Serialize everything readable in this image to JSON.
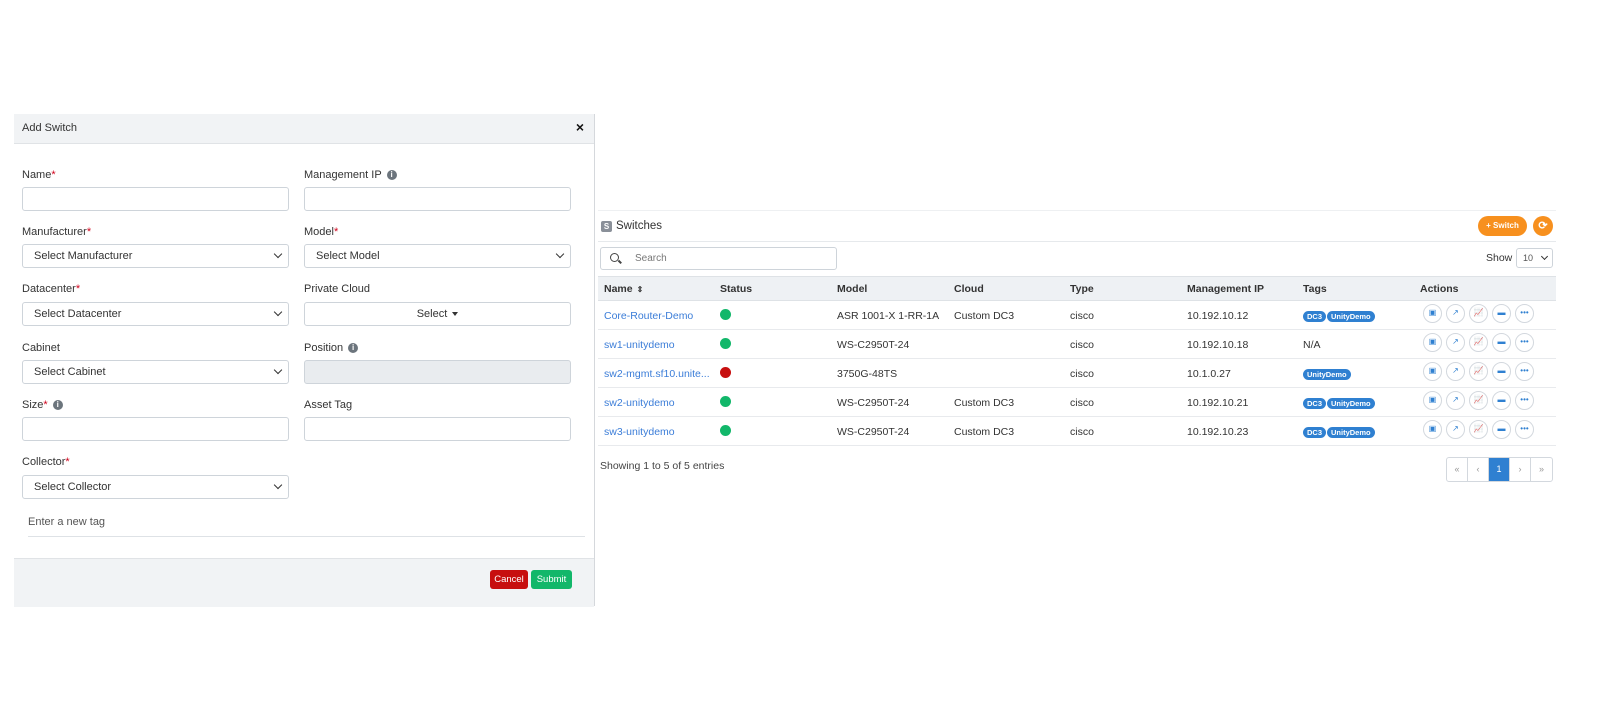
{
  "modal": {
    "title": "Add Switch",
    "close_icon": "×",
    "fields": {
      "name": {
        "label": "Name",
        "required": "*"
      },
      "management_ip": {
        "label": "Management IP",
        "info": "i"
      },
      "manufacturer": {
        "label": "Manufacturer",
        "required": "*",
        "value": "Select Manufacturer"
      },
      "model": {
        "label": "Model",
        "required": "*",
        "value": "Select Model"
      },
      "datacenter": {
        "label": "Datacenter",
        "required": "*",
        "value": "Select Datacenter"
      },
      "private_cloud": {
        "label": "Private Cloud",
        "value": "Select"
      },
      "cabinet": {
        "label": "Cabinet",
        "value": "Select Cabinet"
      },
      "position": {
        "label": "Position",
        "info": "i"
      },
      "size": {
        "label": "Size",
        "required": "*",
        "info": "i"
      },
      "asset_tag": {
        "label": "Asset Tag"
      },
      "collector": {
        "label": "Collector",
        "required": "*",
        "value": "Select Collector"
      },
      "tag_input": {
        "placeholder": "Enter a new tag"
      }
    },
    "buttons": {
      "cancel": "Cancel",
      "submit": "Submit"
    }
  },
  "switches": {
    "title": "Switches",
    "icon_letter": "S",
    "add_button": "+ Switch",
    "refresh_icon": "⟳",
    "search_placeholder": "Search",
    "show_label": "Show",
    "page_size": "10",
    "columns": [
      "Name",
      "Status",
      "Model",
      "Cloud",
      "Type",
      "Management IP",
      "Tags",
      "Actions"
    ],
    "sort_icon": "⇕",
    "colors": {
      "up": "#12b76a",
      "down": "#c70f0f",
      "accent": "#f7901e",
      "link": "#3b7dd8"
    },
    "rows": [
      {
        "name": "Core-Router-Demo",
        "status": "up",
        "model": "ASR 1001-X 1-RR-1A",
        "cloud": "Custom DC3",
        "type": "cisco",
        "ip": "10.192.10.12",
        "tags": [
          "DC3",
          "UnityDemo"
        ],
        "tags_text": ""
      },
      {
        "name": "sw1-unitydemo",
        "status": "up",
        "model": "WS-C2950T-24",
        "cloud": "",
        "type": "cisco",
        "ip": "10.192.10.18",
        "tags": [],
        "tags_text": "N/A"
      },
      {
        "name": "sw2-mgmt.sf10.unite...",
        "status": "down",
        "model": "3750G-48TS",
        "cloud": "",
        "type": "cisco",
        "ip": "10.1.0.27",
        "tags": [
          "UnityDemo"
        ],
        "tags_text": ""
      },
      {
        "name": "sw2-unitydemo",
        "status": "up",
        "model": "WS-C2950T-24",
        "cloud": "Custom DC3",
        "type": "cisco",
        "ip": "10.192.10.21",
        "tags": [
          "DC3",
          "UnityDemo"
        ],
        "tags_text": ""
      },
      {
        "name": "sw3-unitydemo",
        "status": "up",
        "model": "WS-C2950T-24",
        "cloud": "Custom DC3",
        "type": "cisco",
        "ip": "10.192.10.23",
        "tags": [
          "DC3",
          "UnityDemo"
        ],
        "tags_text": ""
      }
    ],
    "action_icons": [
      "console-icon",
      "external-link-icon",
      "chart-icon",
      "terminal-icon",
      "more-icon"
    ],
    "action_glyphs": [
      "▣",
      "↗",
      "📈",
      "▬",
      "•••"
    ],
    "info_text": "Showing 1 to 5 of 5 entries",
    "pager": [
      "«",
      "‹",
      "1",
      "›",
      "»"
    ],
    "current_page": "1"
  }
}
